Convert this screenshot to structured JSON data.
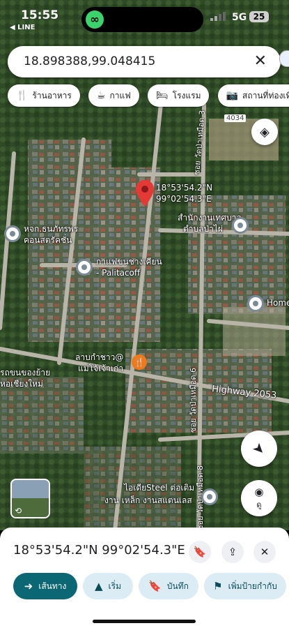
{
  "status": {
    "time": "15:55",
    "back_app": "◀ LINE",
    "network": "5G",
    "battery": "25"
  },
  "search": {
    "value": "18.898388,99.048415",
    "clear_icon": "close-icon"
  },
  "chips": [
    {
      "icon": "🍴",
      "label": "ร้านอาหาร"
    },
    {
      "icon": "☕",
      "label": "กาแฟ"
    },
    {
      "icon": "🛏",
      "label": "โรงแรม"
    },
    {
      "icon": "📷",
      "label": "สถานที่ท่องเที่ยว"
    },
    {
      "icon": "🍸",
      "label": ""
    }
  ],
  "map": {
    "pin_label_lat": "18°53'54.2\"N",
    "pin_label_lng": "99°02'54.3\"E",
    "road_shield": "4034",
    "labels": {
      "office_1": "สำนักงานเทศบาล",
      "office_2": "ตำบลป่าไผ่",
      "store_1": "หจก.ธนภัทรพร",
      "store_2": "คอนสตรัคชั่น",
      "cafe_1": "กาแฟขนชางเคียน",
      "cafe_2": "- Palitacoff",
      "food_1": "ลาบกำชาว@",
      "food_2": "แม่โจ้เจ้าเก่า",
      "home": "Home",
      "highway": "Highway 2053",
      "left_1": "รถขนของย้าย",
      "left_2": "หอเชียงใหม่",
      "steel_1": "ไอเดียSteel ต่อเติม",
      "steel_2": "งาน เหล็ก งานสแตนเลส",
      "soi_1": "ซอย วัดป่าเหมือด 3",
      "soi_2": "ซอย วัดป่าเหมือด 6",
      "soi_3": "ซอย วัดป่าเหมือด 8"
    },
    "lens_label": "ดู"
  },
  "sheet": {
    "title": "18°53'54.2\"N 99°02'54.3\"E",
    "actions": [
      {
        "icon": "➜",
        "label": "เส้นทาง"
      },
      {
        "icon": "▲",
        "label": "เริ่ม"
      },
      {
        "icon": "🔖",
        "label": "บันทึก"
      },
      {
        "icon": "⚑",
        "label": "เพิ่มป้ายกำกับ"
      }
    ]
  },
  "colors": {
    "accent": "#0b6774",
    "pin": "#e53935"
  }
}
